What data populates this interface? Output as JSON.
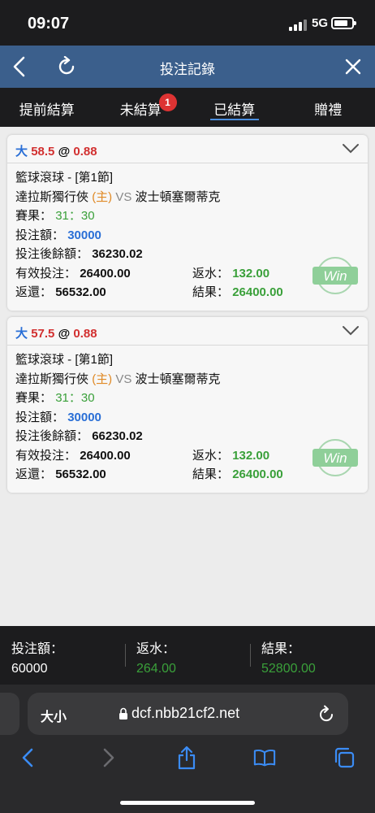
{
  "status_bar": {
    "time": "09:07",
    "network": "5G"
  },
  "header": {
    "title": "投注記錄"
  },
  "tabs": [
    {
      "label": "提前結算"
    },
    {
      "label": "未結算",
      "badge": "1"
    },
    {
      "label": "已結算"
    },
    {
      "label": "贈禮"
    }
  ],
  "bets": [
    {
      "type": "大",
      "line": "58.5",
      "at": "@",
      "odds": "0.88",
      "league": "籃球滾球 - [第1節]",
      "home": "達拉斯獨行俠",
      "home_tag": "(主)",
      "vs": "VS",
      "away": "波士頓塞爾蒂克",
      "score_label": "賽果：",
      "score": "31：30",
      "stake_label": "投注額：",
      "stake": "30000",
      "balance_label": "投注後餘額：",
      "balance": "36230.02",
      "valid_label": "有效投注：",
      "valid": "26400.00",
      "rebate_label": "返水：",
      "rebate": "132.00",
      "return_label": "返還：",
      "return": "56532.00",
      "result_label": "結果：",
      "result": "26400.00",
      "stamp": "Win"
    },
    {
      "type": "大",
      "line": "57.5",
      "at": "@",
      "odds": "0.88",
      "league": "籃球滾球 - [第1節]",
      "home": "達拉斯獨行俠",
      "home_tag": "(主)",
      "vs": "VS",
      "away": "波士頓塞爾蒂克",
      "score_label": "賽果：",
      "score": "31：30",
      "stake_label": "投注額：",
      "stake": "30000",
      "balance_label": "投注後餘額：",
      "balance": "66230.02",
      "valid_label": "有效投注：",
      "valid": "26400.00",
      "rebate_label": "返水：",
      "rebate": "132.00",
      "return_label": "返還：",
      "return": "56532.00",
      "result_label": "結果：",
      "result": "26400.00",
      "stamp": "Win"
    }
  ],
  "summary": {
    "stake_label": "投注額：",
    "stake": "60000",
    "rebate_label": "返水：",
    "rebate": "264.00",
    "result_label": "結果：",
    "result": "52800.00"
  },
  "browser": {
    "text_size": "大小",
    "url": "dcf.nbb21cf2.net"
  },
  "colors": {
    "header_bg": "#3b5f8c",
    "dark_bg": "#1c1c1e",
    "accent_blue": "#2a6fd6",
    "odds_red": "#d23030",
    "win_green": "#3aa03a",
    "home_orange": "#e08a26"
  },
  "icons": [
    "back-arrow-icon",
    "refresh-icon",
    "close-icon",
    "chevron-down-icon",
    "win-stamp-icon",
    "lock-icon",
    "reload-icon",
    "share-icon",
    "bookmarks-icon",
    "tabs-icon",
    "forward-arrow-icon"
  ]
}
